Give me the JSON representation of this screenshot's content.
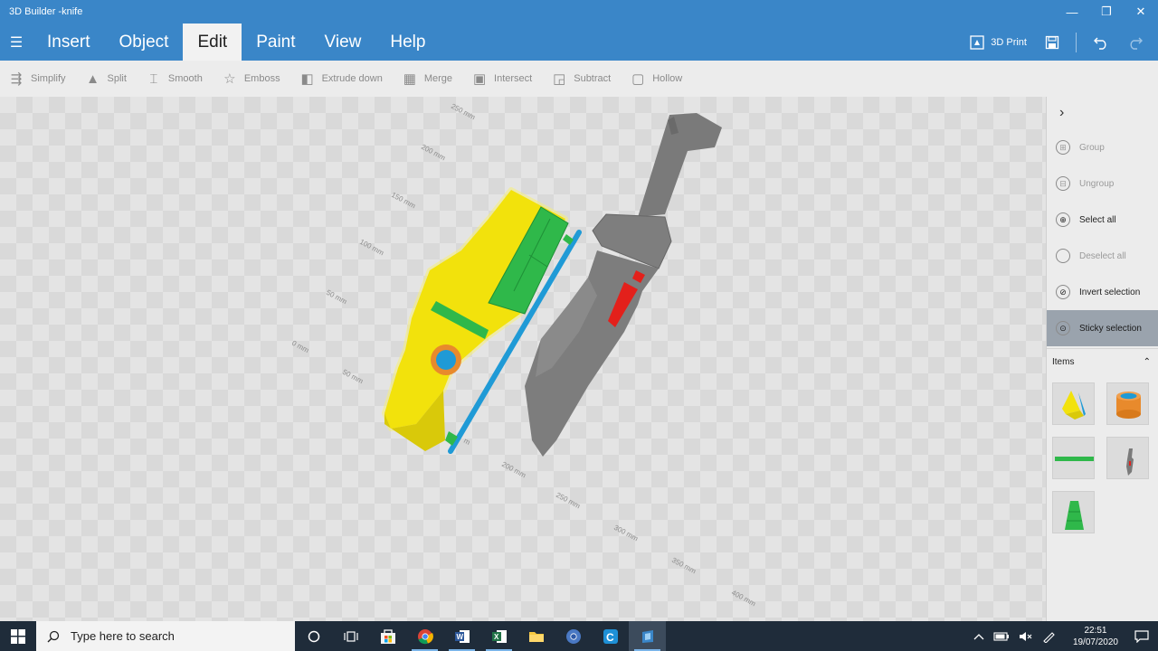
{
  "window": {
    "title": "3D Builder -knife",
    "minimize_icon": "—",
    "maximize_icon": "❐",
    "close_icon": "✕"
  },
  "menubar": {
    "hamburger": "☰",
    "items": [
      "Insert",
      "Object",
      "Edit",
      "Paint",
      "View",
      "Help"
    ],
    "active": "Edit",
    "print_label": "3D Print"
  },
  "toolbar": {
    "tools": [
      {
        "label": "Simplify",
        "icon": "simplify-icon",
        "glyph": "⇶"
      },
      {
        "label": "Split",
        "icon": "split-icon",
        "glyph": "▲"
      },
      {
        "label": "Smooth",
        "icon": "smooth-icon",
        "glyph": "⌶"
      },
      {
        "label": "Emboss",
        "icon": "emboss-icon",
        "glyph": "☆"
      },
      {
        "label": "Extrude down",
        "icon": "extrude-down-icon",
        "glyph": "◧"
      },
      {
        "label": "Merge",
        "icon": "merge-icon",
        "glyph": "▦"
      },
      {
        "label": "Intersect",
        "icon": "intersect-icon",
        "glyph": "▣"
      },
      {
        "label": "Subtract",
        "icon": "subtract-icon",
        "glyph": "◲"
      },
      {
        "label": "Hollow",
        "icon": "hollow-icon",
        "glyph": "▢"
      }
    ]
  },
  "viewport": {
    "ruler_labels": [
      "250 mm",
      "200 mm",
      "150 mm",
      "100 mm",
      "50 mm",
      "0 mm",
      "50 mm",
      "200 mm",
      "250 mm",
      "300 mm",
      "350 mm",
      "400 mm"
    ],
    "partial_label": "m"
  },
  "panel": {
    "chevron": "›",
    "actions": [
      {
        "label": "Group",
        "enabled": false,
        "icon": "group-icon",
        "glyph": "⊞"
      },
      {
        "label": "Ungroup",
        "enabled": false,
        "icon": "ungroup-icon",
        "glyph": "⊟"
      },
      {
        "label": "Select all",
        "enabled": true,
        "icon": "select-all-icon",
        "glyph": "⊕"
      },
      {
        "label": "Deselect all",
        "enabled": false,
        "icon": "deselect-all-icon",
        "glyph": ""
      },
      {
        "label": "Invert selection",
        "enabled": true,
        "icon": "invert-selection-icon",
        "glyph": "⊘"
      },
      {
        "label": "Sticky selection",
        "enabled": true,
        "active": true,
        "icon": "sticky-selection-icon",
        "glyph": "⊙"
      }
    ],
    "items_label": "Items",
    "items_toggle": "⌃",
    "items": [
      "yellow-blue-block",
      "orange-cylinder",
      "green-bar",
      "grey-knife",
      "green-trapezoid"
    ]
  },
  "taskbar": {
    "search_placeholder": "Type here to search",
    "time": "22:51",
    "date": "19/07/2020",
    "apps": [
      "cortana",
      "task-view",
      "store",
      "chrome",
      "word",
      "excel",
      "file-explorer",
      "chrome-alt",
      "edge",
      "3d-builder"
    ],
    "active_app": "3d-builder"
  }
}
